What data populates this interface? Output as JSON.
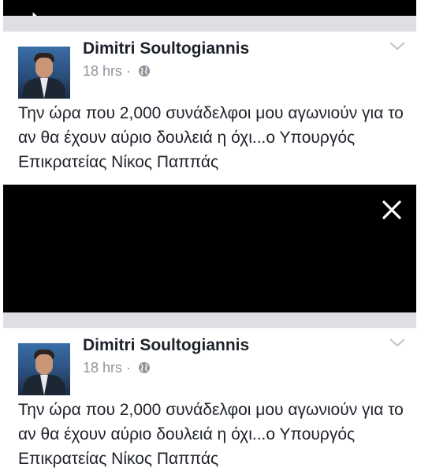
{
  "posts": [
    {
      "author": "Dimitri Soultogiannis",
      "time": "18 hrs",
      "separator": "·",
      "text": "Την ώρα που 2,000 συνάδελφοι μου αγωνιούν για το αν θα έχουν αύριο δουλειά η όχι...ο Υπουργός Επικρατείας Νίκος Παππάς"
    },
    {
      "author": "Dimitri Soultogiannis",
      "time": "18 hrs",
      "separator": "·",
      "text": "Την ώρα που 2,000 συνάδελφοι μου αγωνιούν για το αν θα έχουν αύριο δουλειά η όχι...ο Υπουργός Επικρατείας Νίκος Παππάς"
    }
  ],
  "icons": {
    "cursor": "mouse-cursor-icon",
    "globe": "globe-icon",
    "chevron": "chevron-down-icon",
    "close": "close-icon"
  },
  "colors": {
    "author": "#1d2129",
    "meta": "#90949c",
    "divider": "#dddfe2",
    "overlay": "#000000"
  }
}
